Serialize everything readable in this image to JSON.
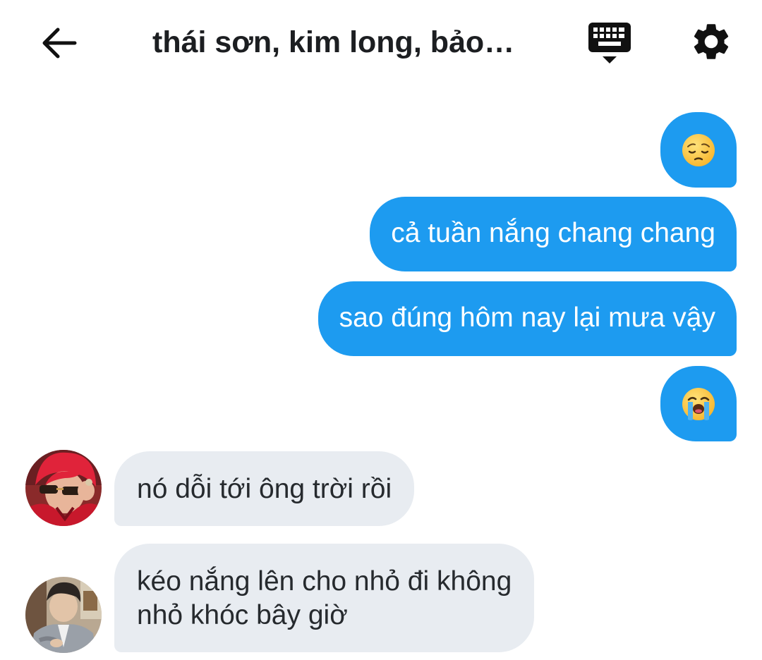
{
  "header": {
    "title": "thái sơn, kim long, bảo…",
    "back_icon": "arrow-left-icon",
    "keyboard_icon": "keyboard-icon",
    "settings_icon": "gear-icon"
  },
  "colors": {
    "outgoing_bubble": "#1d9bf0",
    "incoming_bubble": "#e8ecf1",
    "text_dark": "#1c1e21"
  },
  "messages": [
    {
      "direction": "outgoing",
      "type": "emoji",
      "emoji": "pensive-face-emoji"
    },
    {
      "direction": "outgoing",
      "type": "text",
      "text": "cả tuần nắng chang chang"
    },
    {
      "direction": "outgoing",
      "type": "text",
      "text": "sao đúng hôm nay lại mưa vậy"
    },
    {
      "direction": "outgoing",
      "type": "emoji",
      "emoji": "loudly-crying-face-emoji"
    },
    {
      "direction": "incoming",
      "type": "text",
      "avatar": "avatar-red-hair-sunglasses",
      "lines": [
        "nó dỗi tới ông trời rồi"
      ]
    },
    {
      "direction": "incoming",
      "type": "text",
      "avatar": "avatar-grey-cardigan",
      "lines": [
        "kéo nắng lên cho nhỏ đi không",
        "nhỏ khóc bây giờ"
      ]
    }
  ]
}
